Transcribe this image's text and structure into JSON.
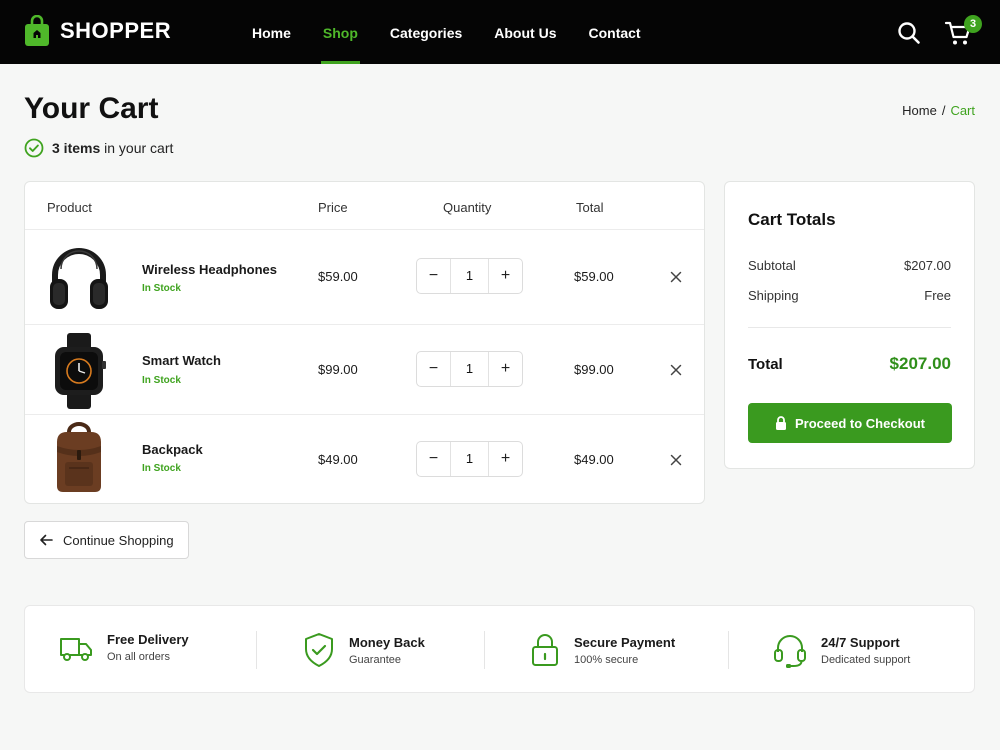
{
  "header": {
    "logo_text": "SHOPPER",
    "nav": [
      {
        "label": "Home",
        "active": false
      },
      {
        "label": "Shop",
        "active": true
      },
      {
        "label": "Categories",
        "active": false
      },
      {
        "label": "About Us",
        "active": false
      },
      {
        "label": "Contact",
        "active": false
      }
    ],
    "cart_count": "3"
  },
  "page": {
    "title": "Your Cart",
    "breadcrumb": {
      "home": "Home",
      "separator": "/",
      "current": "Cart"
    },
    "items_count_bold": "3 items",
    "items_count_rest": "in your cart"
  },
  "table": {
    "headers": {
      "product": "Product",
      "price": "Price",
      "quantity": "Quantity",
      "total": "Total"
    },
    "rows": [
      {
        "name": "Wireless Headphones",
        "stock": "In Stock",
        "price": "$59.00",
        "qty": "1",
        "total": "$59.00",
        "icon": "headphones-icon"
      },
      {
        "name": "Smart Watch",
        "stock": "In Stock",
        "price": "$99.00",
        "qty": "1",
        "total": "$99.00",
        "icon": "smart-watch-icon"
      },
      {
        "name": "Backpack",
        "stock": "In Stock",
        "price": "$49.00",
        "qty": "1",
        "total": "$49.00",
        "icon": "backpack-icon"
      }
    ],
    "qty_minus": "−",
    "qty_plus": "+"
  },
  "totals": {
    "title": "Cart Totals",
    "subtotal_label": "Subtotal",
    "subtotal_value": "$207.00",
    "shipping_label": "Shipping",
    "shipping_value": "Free",
    "total_label": "Total",
    "total_value": "$207.00",
    "checkout_label": "Proceed to Checkout"
  },
  "continue_label": "Continue Shopping",
  "features": [
    {
      "title": "Free Delivery",
      "sub": "On all orders",
      "icon": "truck-icon"
    },
    {
      "title": "Money Back",
      "sub": "Guarantee",
      "icon": "shield-check-icon"
    },
    {
      "title": "Secure Payment",
      "sub": "100% secure",
      "icon": "lock-icon"
    },
    {
      "title": "24/7 Support",
      "sub": "Dedicated support",
      "icon": "headset-icon"
    }
  ],
  "colors": {
    "accent": "#3fa31f",
    "header_bg": "#050505",
    "total_green": "#2f8f1a"
  }
}
